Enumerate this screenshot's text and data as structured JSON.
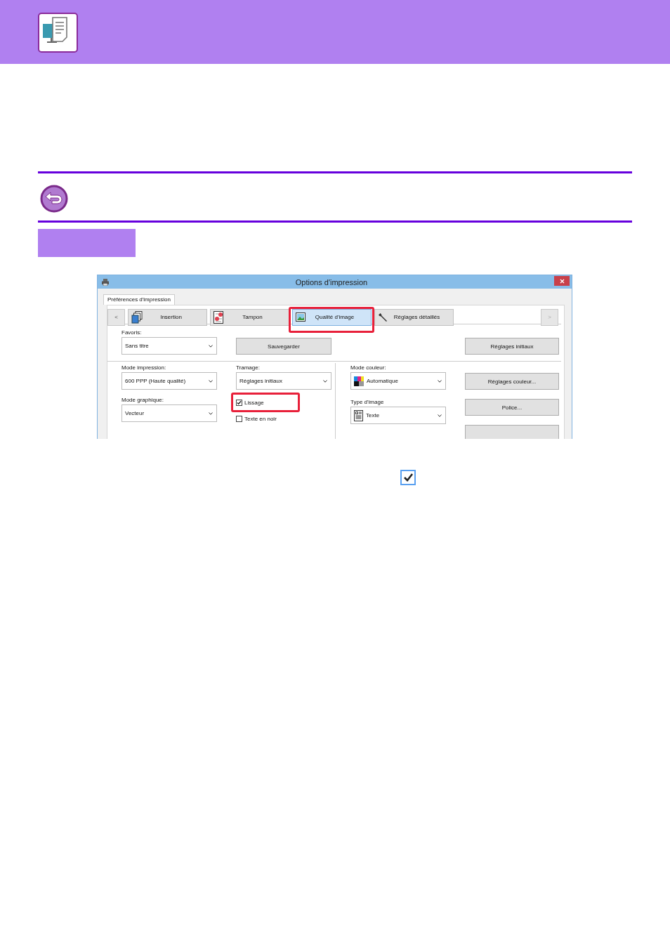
{
  "dialog": {
    "title": "Options d'impression",
    "page_tab": {
      "label": "Préférences d'impression",
      "selected": true
    },
    "nav": {
      "prev": "<",
      "next": ">"
    },
    "tabs": [
      {
        "label": "Insertion",
        "selected": false,
        "highlighted": false
      },
      {
        "label": "Tampon",
        "selected": false,
        "highlighted": false
      },
      {
        "label": "Qualité d'image",
        "selected": true,
        "highlighted": true
      },
      {
        "label": "Réglages détaillés",
        "selected": false,
        "highlighted": false
      }
    ],
    "favorites": {
      "label": "Favoris:",
      "value": "Sans titre"
    },
    "save_button": "Sauvegarder",
    "defaults_button": "Réglages initiaux",
    "columns": [
      [
        {
          "kind": "select",
          "label": "Mode impression:",
          "value": "600 PPP (Haute qualité)"
        },
        {
          "kind": "select",
          "label": "Mode graphique:",
          "value": "Vecteur"
        }
      ],
      [
        {
          "kind": "select",
          "label": "Tramage:",
          "value": "Réglages initiaux"
        },
        {
          "kind": "checkbox",
          "label": "Lissage",
          "checked": true,
          "highlighted": true
        },
        {
          "kind": "checkbox",
          "label": "Texte en noir",
          "checked": false,
          "highlighted": false
        }
      ],
      [
        {
          "kind": "select",
          "label": "Mode couleur:",
          "value": "Automatique"
        },
        {
          "kind": "select",
          "label": "Type d'image",
          "value": "Texte"
        }
      ],
      [
        {
          "kind": "button",
          "label": "Réglages couleur..."
        },
        {
          "kind": "button",
          "label": "Police..."
        },
        {
          "kind": "button"
        }
      ]
    ]
  }
}
